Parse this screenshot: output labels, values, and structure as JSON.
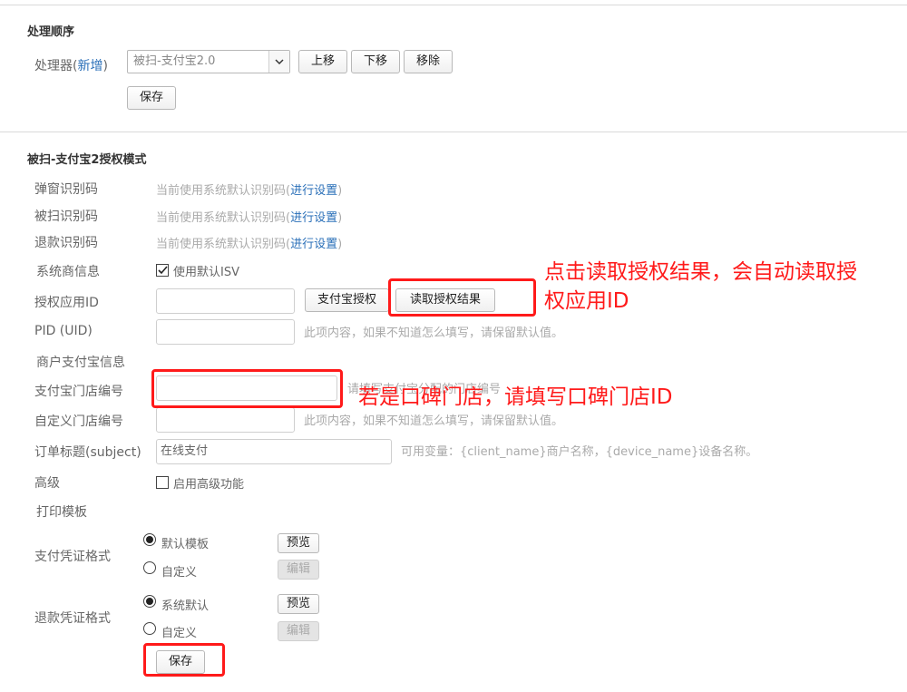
{
  "order_section": {
    "title": "处理顺序",
    "processor_label": "处理器(",
    "processor_add_link": "新增",
    "processor_label_end": ")",
    "processor_select_value": "被扫-支付宝2.0",
    "move_up": "上移",
    "move_down": "下移",
    "remove": "移除",
    "save": "保存"
  },
  "auth_section": {
    "title": "被扫-支付宝2授权模式",
    "rows": [
      {
        "label": "弹窗识别码",
        "text": "当前使用系统默认识别码(",
        "link": "进行设置",
        "end": ")"
      },
      {
        "label": "被扫识别码",
        "text": "当前使用系统默认识别码(",
        "link": "进行设置",
        "end": ")"
      },
      {
        "label": "退款识别码",
        "text": "当前使用系统默认识别码(",
        "link": "进行设置",
        "end": ")"
      }
    ],
    "isv_label": "系统商信息",
    "isv_checkbox_label": "使用默认ISV",
    "app_id_label": "授权应用ID",
    "app_id_value": "",
    "alipay_auth_button": "支付宝授权",
    "read_auth_button": "读取授权结果",
    "pid_label": "PID (UID)",
    "pid_value": "",
    "pid_hint": "此项内容，如果不知道怎么填写，请保留默认值。",
    "merchant_info_label": "商户支付宝信息",
    "store_no_label": "支付宝门店编号",
    "store_no_value": "",
    "store_no_hint": "请填写支付宝分配的门店编号",
    "custom_store_label": "自定义门店编号",
    "custom_store_value": "",
    "custom_store_hint": "此项内容，如果不知道怎么填写，请保留默认值。",
    "subject_label": "订单标题(subject)",
    "subject_value": "在线支付",
    "subject_hint": "可用变量：{client_name}商户名称，{device_name}设备名称。",
    "advanced_label": "高级",
    "advanced_checkbox_label": "启用高级功能",
    "print_template_label": "打印模板",
    "pay_voucher_label": "支付凭证格式",
    "pay_default_option": "默认模板",
    "pay_custom_option": "自定义",
    "refund_voucher_label": "退款凭证格式",
    "refund_default_option": "系统默认",
    "refund_custom_option": "自定义",
    "preview": "预览",
    "edit": "编辑",
    "save": "保存"
  },
  "annotations": {
    "read_auth_note_line1": "点击读取授权结果，会自动读取授",
    "read_auth_note_line2": "权应用ID",
    "store_note": "若是口碑门店，请填写口碑门店ID",
    "color": "#ff1a1a"
  }
}
